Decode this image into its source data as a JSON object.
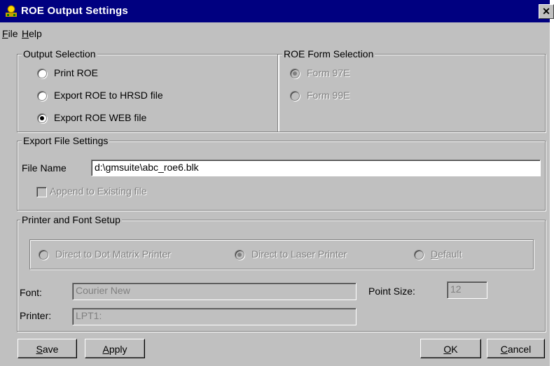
{
  "window": {
    "title": "ROE Output Settings",
    "close_glyph": "✕",
    "icon": "app-icon"
  },
  "menu": {
    "file_first": "F",
    "file_rest": "ile",
    "help_first": "H",
    "help_rest": "elp"
  },
  "output_selection": {
    "label": "Output Selection",
    "options": [
      {
        "label": "Print ROE",
        "selected": false
      },
      {
        "label": "Export ROE to HRSD file",
        "selected": false
      },
      {
        "label": "Export ROE WEB file",
        "selected": true
      }
    ]
  },
  "form_selection": {
    "label": "ROE Form Selection",
    "options": [
      {
        "label": "Form 97E",
        "selected": true,
        "enabled": false
      },
      {
        "label": "Form 99E",
        "selected": false,
        "enabled": false
      }
    ]
  },
  "export_settings": {
    "label": "Export File Settings",
    "file_name_label": "File Name",
    "file_name_value": "d:\\gmsuite\\abc_roe6.blk",
    "append_label": "Append to Existing file",
    "append_checked": false
  },
  "printer_setup": {
    "label": "Printer and Font Setup",
    "options": [
      {
        "label": "Direct to Dot Matrix Printer",
        "selected": false
      },
      {
        "label": "Direct to Laser Printer",
        "selected": true
      },
      {
        "label_first": "D",
        "label_rest": "efault",
        "selected": false
      }
    ],
    "font_label": "Font:",
    "font_value": "Courier New",
    "point_size_label": "Point Size:",
    "point_size_value": "12",
    "printer_label": "Printer:",
    "printer_value": "LPT1:"
  },
  "buttons": {
    "save_first": "S",
    "save_rest": "ave",
    "apply_first": "A",
    "apply_rest": "pply",
    "ok_first": "O",
    "ok_rest": "K",
    "cancel_first": "C",
    "cancel_rest": "ancel"
  }
}
